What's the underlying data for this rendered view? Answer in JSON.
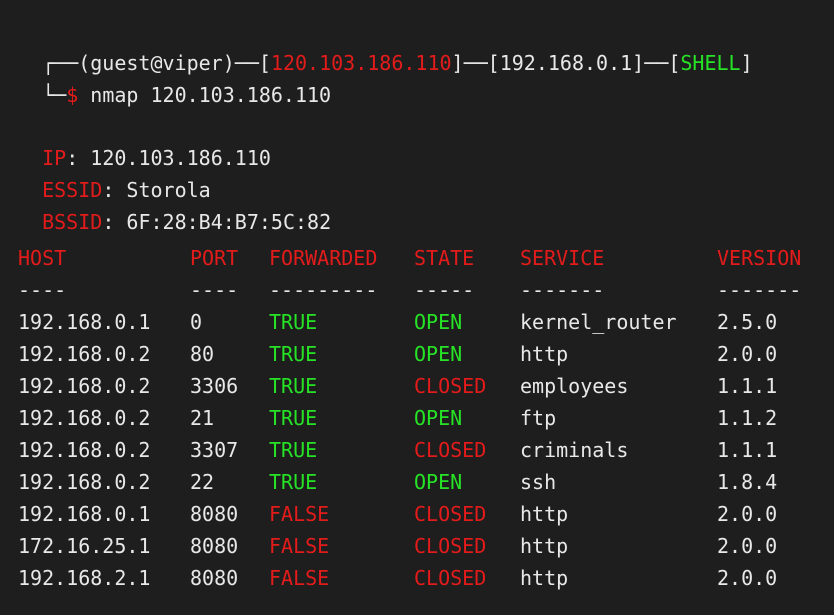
{
  "prompt": {
    "corner_top": "┌──",
    "user_host": "(guest@viper)",
    "dash1": "─",
    "bracket_open1": "[",
    "target_ip": "120.103.186.110",
    "bracket_close1": "]",
    "dash2": "──",
    "gateway": "[192.168.0.1]",
    "dash3": "──",
    "bracket_open3": "[",
    "mode": "SHELL",
    "bracket_close3": "]",
    "corner_bottom": "└─",
    "symbol": "$",
    "command": " nmap 120.103.186.110"
  },
  "info": [
    {
      "key": "IP",
      "sep": ": ",
      "value": "120.103.186.110"
    },
    {
      "key": "ESSID",
      "sep": ": ",
      "value": "Storola"
    },
    {
      "key": "BSSID",
      "sep": ": ",
      "value": "6F:28:B4:B7:5C:82"
    }
  ],
  "table": {
    "headers": {
      "host": "HOST",
      "port": "PORT",
      "forwarded": "FORWARDED",
      "state": "STATE",
      "service": "SERVICE",
      "version": "VERSION"
    },
    "separators": {
      "host": "----",
      "port": "----",
      "forwarded": "---------",
      "state": "-----",
      "service": "-------",
      "version": "-------"
    },
    "rows": [
      {
        "host": "192.168.0.1",
        "port": "0",
        "forwarded": "TRUE",
        "state": "OPEN",
        "service": "kernel_router",
        "version": "2.5.0"
      },
      {
        "host": "192.168.0.2",
        "port": "80",
        "forwarded": "TRUE",
        "state": "OPEN",
        "service": "http",
        "version": "2.0.0"
      },
      {
        "host": "192.168.0.2",
        "port": "3306",
        "forwarded": "TRUE",
        "state": "CLOSED",
        "service": "employees",
        "version": "1.1.1"
      },
      {
        "host": "192.168.0.2",
        "port": "21",
        "forwarded": "TRUE",
        "state": "OPEN",
        "service": "ftp",
        "version": "1.1.2"
      },
      {
        "host": "192.168.0.2",
        "port": "3307",
        "forwarded": "TRUE",
        "state": "CLOSED",
        "service": "criminals",
        "version": "1.1.1"
      },
      {
        "host": "192.168.0.2",
        "port": "22",
        "forwarded": "TRUE",
        "state": "OPEN",
        "service": "ssh",
        "version": "1.8.4"
      },
      {
        "host": "192.168.0.1",
        "port": "8080",
        "forwarded": "FALSE",
        "state": "CLOSED",
        "service": "http",
        "version": "2.0.0"
      },
      {
        "host": "172.16.25.1",
        "port": "8080",
        "forwarded": "FALSE",
        "state": "CLOSED",
        "service": "http",
        "version": "2.0.0"
      },
      {
        "host": "192.168.2.1",
        "port": "8080",
        "forwarded": "FALSE",
        "state": "CLOSED",
        "service": "http",
        "version": "2.0.0"
      }
    ]
  },
  "colors": {
    "background": "#1e1e1e",
    "text": "#e8e8e8",
    "red": "#e31b1b",
    "green": "#26e326"
  }
}
